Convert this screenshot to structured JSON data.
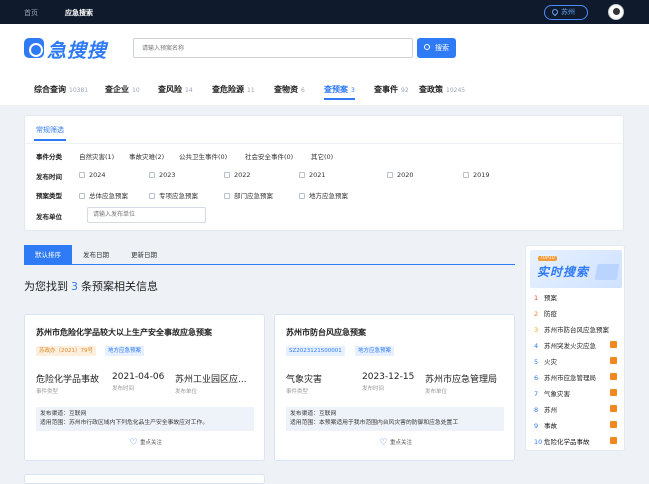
{
  "topbar": {
    "home": "首页",
    "current": "应急搜索",
    "location": "苏州"
  },
  "header": {
    "logo_text": "急搜搜",
    "search_placeholder": "请输入预案名称",
    "search_button": "搜索",
    "tabs": [
      {
        "label": "综合查询",
        "count": "10381"
      },
      {
        "label": "查企业",
        "count": "10"
      },
      {
        "label": "查风险",
        "count": "14"
      },
      {
        "label": "查危险源",
        "count": "11"
      },
      {
        "label": "查物资",
        "count": "6"
      },
      {
        "label": "查预案",
        "count": "3"
      },
      {
        "label": "查事件",
        "count": "92"
      },
      {
        "label": "查政策",
        "count": "10245"
      }
    ]
  },
  "filter": {
    "tab": "常规筛选",
    "event_type": {
      "label": "事件分类",
      "options": [
        "自然灾害(1)",
        "事故灾难(2)",
        "公共卫生事件(0)",
        "社会安全事件(0)",
        "其它(0)"
      ]
    },
    "publish_time": {
      "label": "发布时间",
      "options": [
        "2024",
        "2023",
        "2022",
        "2021",
        "2020",
        "2019"
      ]
    },
    "plan_type": {
      "label": "预案类型",
      "options": [
        "总体应急预案",
        "专项应急预案",
        "部门应急预案",
        "地方应急预案"
      ]
    },
    "publisher": {
      "label": "发布单位",
      "placeholder": "请输入发布单位"
    }
  },
  "sort": {
    "tabs": [
      "默认排序",
      "发布日期",
      "更新日期"
    ]
  },
  "results": {
    "prefix": "为您找到",
    "count": "3",
    "suffix": "条预案相关信息"
  },
  "cards": [
    {
      "title": "苏州市危险化学品较大以上生产安全事故应急预案",
      "tag1": "苏政办（2021）79号",
      "tag2": "地方应急预案",
      "event_type": "危险化学品事故",
      "event_type_label": "事件类型",
      "publish_time": "2021-04-06",
      "publish_time_label": "发布时间",
      "publisher": "苏州工业园区应...",
      "publisher_label": "发布单位",
      "channel": "发布渠道：互联网",
      "scope": "适用范围：苏州市行政区域内下列危化品生产安全事故应对工作。",
      "follow": "重点关注"
    },
    {
      "title": "苏州市防台风应急预案",
      "tag1": "SZ2023121500001",
      "tag2": "地方应急预案",
      "event_type": "气象灾害",
      "event_type_label": "事件类型",
      "publish_time": "2023-12-15",
      "publish_time_label": "发布时间",
      "publisher": "苏州市应急管理局",
      "publisher_label": "发布单位",
      "channel": "发布渠道：互联网",
      "scope": "适用范围：本预案适用于我市范围内台风灾害的防御和应急处置工",
      "follow": "重点关注"
    }
  ],
  "hot": {
    "badge": "TOP10",
    "title": "实时搜索",
    "items": [
      "预案",
      "防疫",
      "苏州市防台风应急预案",
      "苏州突发火灾应急",
      "火灾",
      "苏州市应急管理局",
      "气象灾害",
      "苏州",
      "事故",
      "危险化学品事故"
    ],
    "ranks": [
      "1",
      "2",
      "3",
      "4",
      "5",
      "6",
      "7",
      "8",
      "9",
      "10"
    ]
  }
}
